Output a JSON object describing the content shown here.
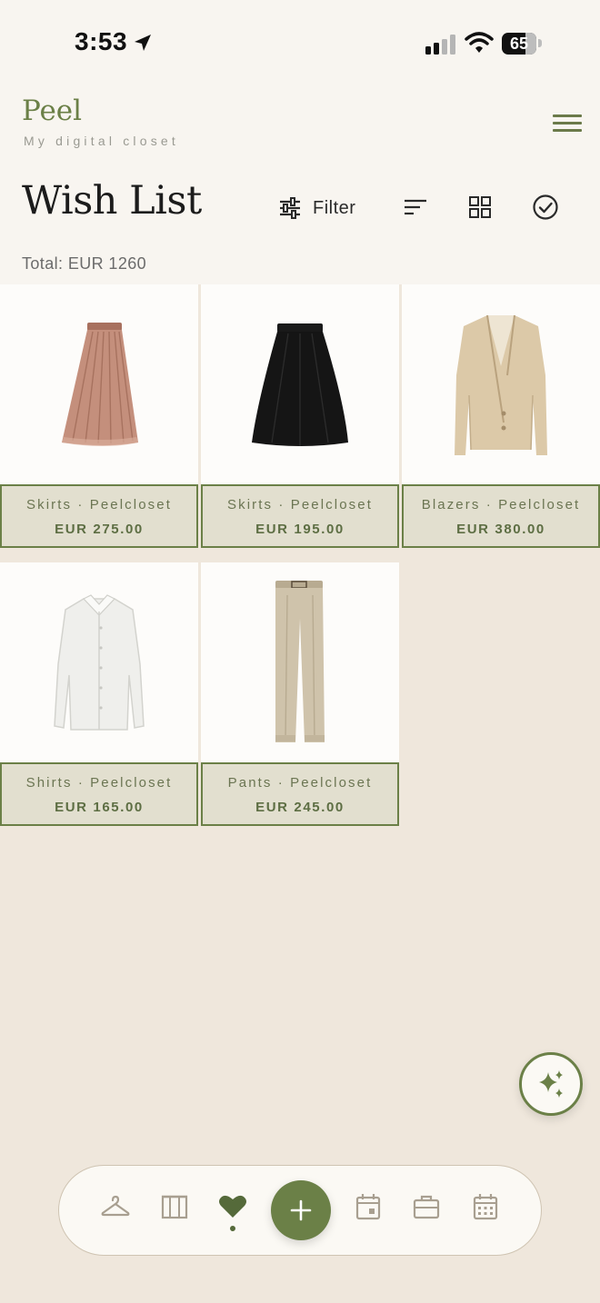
{
  "status_bar": {
    "time": "3:53",
    "battery": "65"
  },
  "app": {
    "name": "Peel",
    "tagline": "My digital closet"
  },
  "page": {
    "title": "Wish List",
    "filter_label": "Filter",
    "total": "Total: EUR 1260"
  },
  "items": [
    {
      "category_store": "Skirts · Peelcloset",
      "price": "EUR 275.00",
      "image": "pleated tulle skirt"
    },
    {
      "category_store": "Skirts · Peelcloset",
      "price": "EUR 195.00",
      "image": "black a-line skirt"
    },
    {
      "category_store": "Blazers · Peelcloset",
      "price": "EUR 380.00",
      "image": "beige blazer"
    },
    {
      "category_store": "Shirts · Peelcloset",
      "price": "EUR 165.00",
      "image": "white button shirt"
    },
    {
      "category_store": "Pants · Peelcloset",
      "price": "EUR 245.00",
      "image": "beige trousers"
    }
  ],
  "bottom_nav": {
    "items": [
      "hanger-icon",
      "wardrobe-icon",
      "heart-icon",
      "add-icon",
      "calendar-day-icon",
      "suitcase-icon",
      "calendar-grid-icon"
    ],
    "active": "heart-icon"
  },
  "colors": {
    "accent": "#6b8047",
    "background": "#efe7dc",
    "header": "#f8f5f0",
    "card_info": "#e2dfcf"
  }
}
